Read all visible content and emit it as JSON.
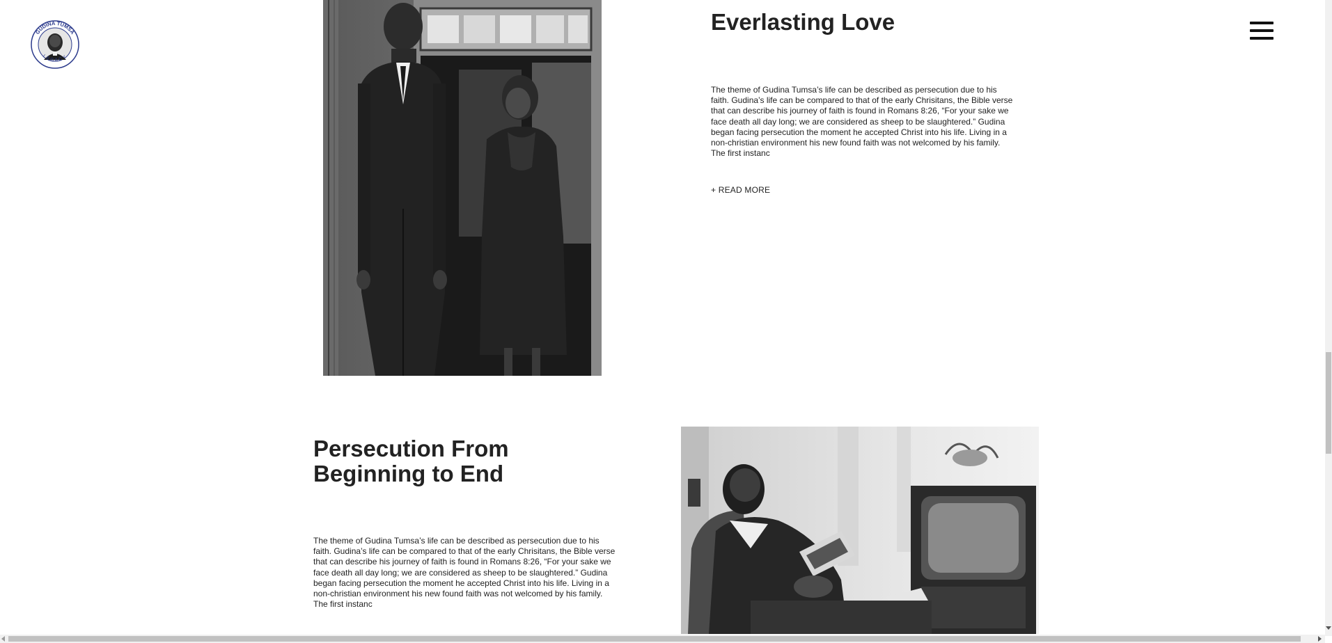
{
  "header": {
    "logo_text_top": "GUDINA TUMSA",
    "logo_text_bottom": "LEGACY",
    "logo_icon": "portrait-seal-icon",
    "menu_icon": "hamburger-menu-icon"
  },
  "sections": [
    {
      "title": "Everlasting Love",
      "body": "The theme of Gudina Tumsa’s life can be described as persecution due to his faith. Gudina’s life can be compared to that of the early Chrisitans, the Bible verse that can describe his journey of faith is found in Romans 8:26, “For your sake we face death all day long; we are considered as sheep to be slaughtered.” Gudina began facing persecution the moment he accepted Christ into his life. Living in a non-christian environment his new found faith was not welcomed by his family. The first instanc",
      "read_more": "+ READ MORE"
    },
    {
      "title": "Persecution From Beginning to End",
      "body": "The theme of Gudina Tumsa’s life can be described as persecution due to his faith. Gudina’s life can be compared to that of the early Chrisitans, the Bible verse that can describe his journey of faith is found in Romans 8:26, “For your sake we face death all day long; we are considered as sheep to be slaughtered.” Gudina began facing persecution the moment he accepted Christ into his life. Living in a non-christian environment his new found faith was not welcomed by his family. The first instanc"
    }
  ],
  "colors": {
    "background": "#ffffff",
    "text": "#222222",
    "logo_ring": "#2b3a8c"
  }
}
